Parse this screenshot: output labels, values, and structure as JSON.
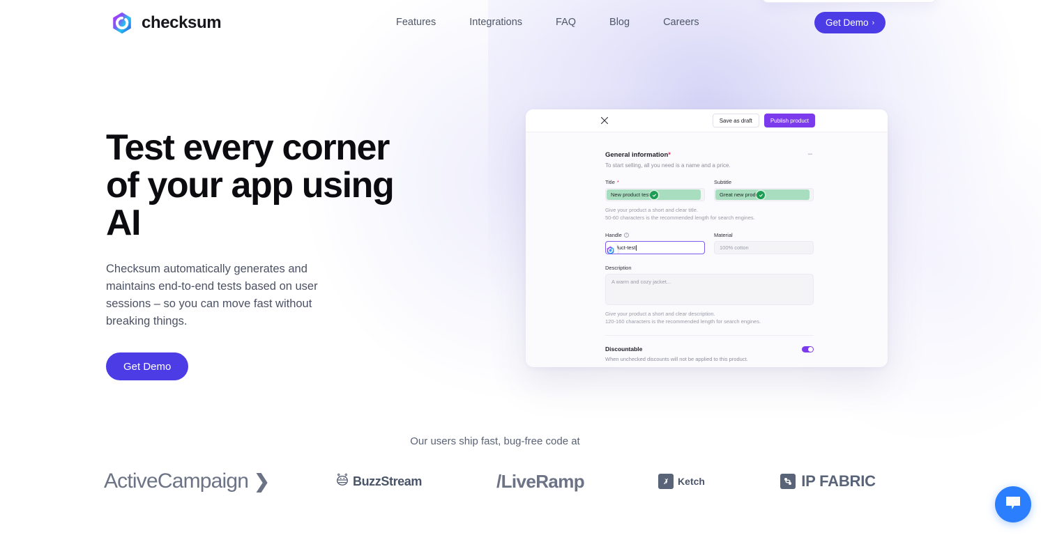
{
  "brand": {
    "name": "checksum",
    "logo_icon": "checksum-hex-logo",
    "accent_color": "#4b3ce6",
    "logo_gradient_from": "#c13dff",
    "logo_gradient_to": "#18c8f0"
  },
  "nav": {
    "items": [
      {
        "label": "Features"
      },
      {
        "label": "Integrations"
      },
      {
        "label": "FAQ"
      },
      {
        "label": "Blog"
      },
      {
        "label": "Careers"
      }
    ],
    "cta": {
      "label": "Get Demo",
      "chevron": "›"
    }
  },
  "hero": {
    "title": "Test every corner of your app using AI",
    "subtitle": "Checksum automatically generates and maintains end-to-end tests based on user sessions – so you can move fast without breaking things.",
    "cta": {
      "label": "Get Demo"
    }
  },
  "product_card": {
    "topbar": {
      "close_icon": "close-icon",
      "save_draft_label": "Save as draft",
      "publish_label": "Publish product",
      "publish_color": "#7c3aed"
    },
    "section": {
      "title": "General information",
      "required_marker": "*",
      "collapse_icon": "–",
      "subtitle": "To start selling, all you need is a name and a price."
    },
    "fields": {
      "title": {
        "label": "Title",
        "required_marker": "*",
        "value": "New product test",
        "state": "validated",
        "highlight_color": "#a9ddc0",
        "check_color": "#1f9d55"
      },
      "subtitle": {
        "label": "Subtitle",
        "value": "Great new produ",
        "state": "validated",
        "highlight_color": "#a9ddc0",
        "check_color": "#1f9d55"
      },
      "title_helper_line1": "Give your product a short and clear title.",
      "title_helper_line2": "50-60 characters is the recommended length for search engines.",
      "handle": {
        "label": "Handle",
        "info_icon": "info-icon",
        "value": "/new-product-test",
        "visible_value": "roduct-test",
        "state": "focused",
        "focus_color": "#7c5cf0",
        "cursor_icon": "checksum-cursor-badge"
      },
      "material": {
        "label": "Material",
        "placeholder": "100% cotton",
        "value": ""
      },
      "description": {
        "label": "Description",
        "placeholder": "A warm and cozy jacket...",
        "value": ""
      },
      "description_helper_line1": "Give your product a short and clear description.",
      "description_helper_line2": "120-160 characters is the recommended length for search engines."
    },
    "discountable": {
      "label": "Discountable",
      "description": "When unchecked discounts will not be applied to this product.",
      "toggle_on": true,
      "toggle_color": "#7c3aed"
    }
  },
  "social_proof": {
    "label": "Our users ship fast, bug-free code at",
    "logos": [
      {
        "name": "ActiveCampaign",
        "text": "ActiveCampaign",
        "mark": "❯"
      },
      {
        "name": "BuzzStream",
        "text": "BuzzStream",
        "icon": "bee-icon"
      },
      {
        "name": "LiveRamp",
        "text": "/LiveRamp"
      },
      {
        "name": "Ketch",
        "text": "Ketch",
        "icon": "ketch-square-icon"
      },
      {
        "name": "IP Fabric",
        "text": "IP FABRIC",
        "icon": "ipfabric-square-icon"
      }
    ]
  },
  "chat_widget": {
    "icon": "chat-bubble-icon",
    "color": "#2b7fff"
  }
}
